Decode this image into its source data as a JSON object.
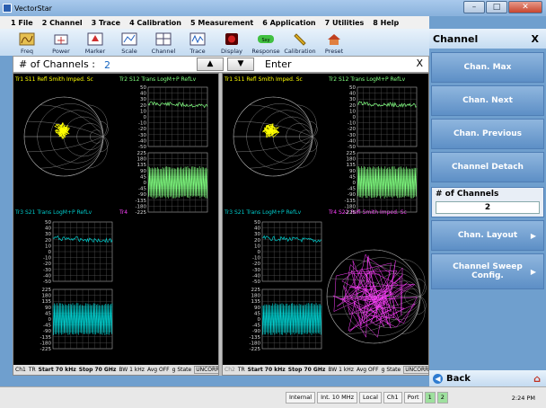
{
  "window": {
    "title": "VectorStar"
  },
  "menu": [
    "1 File",
    "2 Channel",
    "3 Trace",
    "4 Calibration",
    "5 Measurement",
    "6 Application",
    "7 Utilities",
    "8 Help"
  ],
  "toolbar": [
    {
      "label": "Freq",
      "icon": "freq-icon"
    },
    {
      "label": "Power",
      "icon": "power-icon"
    },
    {
      "label": "Marker",
      "icon": "marker-icon"
    },
    {
      "label": "Scale",
      "icon": "scale-icon"
    },
    {
      "label": "Channel",
      "icon": "channel-icon"
    },
    {
      "label": "Trace",
      "icon": "trace-icon"
    },
    {
      "label": "Display",
      "icon": "display-icon"
    },
    {
      "label": "Response",
      "icon": "response-icon"
    },
    {
      "label": "Calibration",
      "icon": "calibration-icon"
    },
    {
      "label": "Preset",
      "icon": "preset-icon"
    }
  ],
  "entry": {
    "label": "# of Channels :",
    "value": "2",
    "enter": "Enter",
    "close": "X",
    "up": "▲",
    "down": "▼"
  },
  "channels": [
    {
      "traces": [
        {
          "label": "Tr1  S11 Refl Smith Imped.  Sc"
        },
        {
          "label": "Tr2  S12 Trans LogM+P RefLv"
        },
        {
          "label": "Tr3  S21 Trans LogM+P RefLv"
        },
        {
          "label": "Tr4"
        }
      ],
      "status": {
        "ch": "Ch1",
        "tr": "TR",
        "start": "Start 70 kHz",
        "stop": "Stop 70 GHz",
        "bw": "BW 1 kHz",
        "avg": "Avg OFF",
        "avg2": "g State",
        "uncorr": "UNCORR"
      }
    },
    {
      "traces": [
        {
          "label": "Tr1  S11 Refl Smith Imped.  Sc"
        },
        {
          "label": "Tr2  S12 Trans LogM+P RefLv"
        },
        {
          "label": "Tr3  S21 Trans LogM+P RefLv"
        },
        {
          "label": "Tr4  S22 Refl Smith Imped.  Sc"
        }
      ],
      "status": {
        "ch": "Ch2",
        "tr": "TR",
        "start": "Start 70 kHz",
        "stop": "Stop 70 GHz",
        "bw": "BW 1 kHz",
        "avg": "Avg OFF",
        "avg2": "g State",
        "uncorr": "UNCORR"
      }
    }
  ],
  "logm_ticks": [
    "50",
    "40",
    "30",
    "20",
    "10",
    "0",
    "-10",
    "-20",
    "-30",
    "-40",
    "-50"
  ],
  "phase_ticks": [
    "225",
    "180",
    "135",
    "90",
    "45",
    "0",
    "-45",
    "-90",
    "-135",
    "-180",
    "-225"
  ],
  "smith_labels": {
    "outer": [
      ".2",
      ".5",
      "1",
      "2",
      "5"
    ],
    "inner": [
      "0",
      ".2",
      ".5",
      "1",
      "2",
      "5"
    ],
    "neg": [
      "-.2",
      "-.5",
      "-1",
      "-2",
      "-5"
    ]
  },
  "panel": {
    "title": "Channel",
    "close": "X",
    "buttons": [
      "Chan. Max",
      "Chan. Next",
      "Chan. Previous",
      "Channel Detach"
    ],
    "num_label": "# of Channels",
    "num_value": "2",
    "layout": "Chan. Layout",
    "sweep": "Channel Sweep Config.",
    "back": "Back"
  },
  "statusbar": {
    "internal": "Internal",
    "ref": "Int. 10 MHz",
    "local": "Local",
    "ch": "Ch1",
    "port": "Port",
    "p1": "1",
    "p2": "2",
    "time": "2:24 PM"
  },
  "colors": {
    "trace1": "#ffff00",
    "trace2": "#80ff80",
    "trace3": "#00cccc",
    "trace4": "#ff40ff",
    "panel": "#6f9fce"
  }
}
